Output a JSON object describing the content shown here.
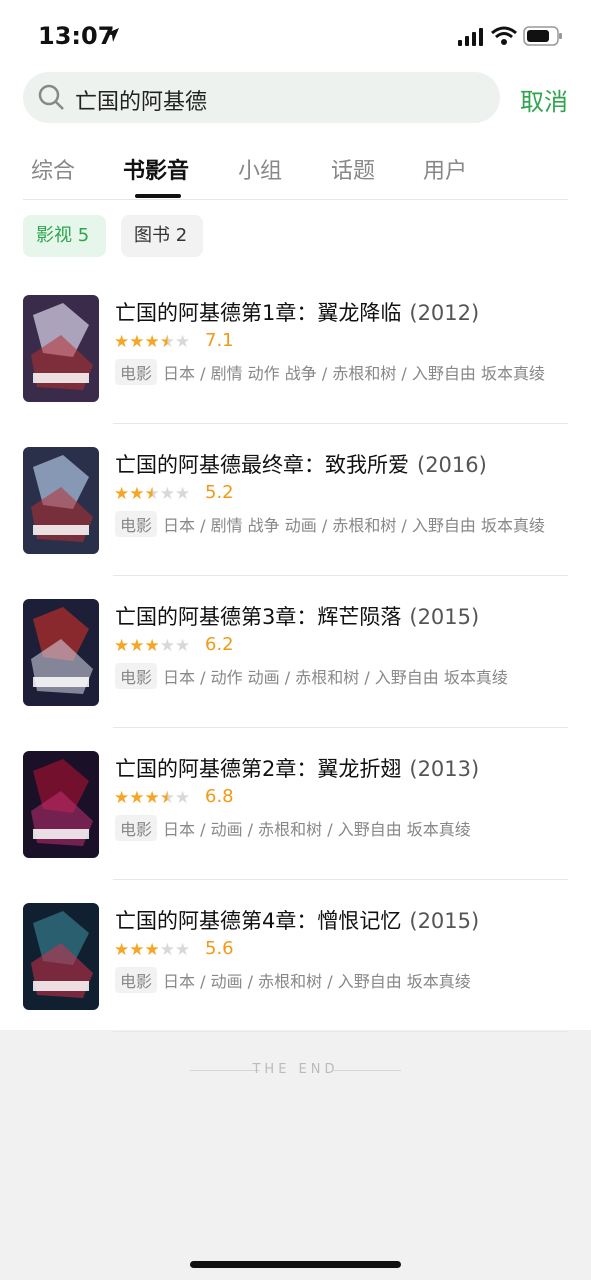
{
  "status": {
    "time": "13:07"
  },
  "search": {
    "query": "亡国的阿基德",
    "cancel_label": "取消"
  },
  "tabs": [
    "综合",
    "书影音",
    "小组",
    "话题",
    "用户"
  ],
  "chips": {
    "movies": "影视 5",
    "books": "图书 2"
  },
  "items": [
    {
      "title": "亡国的阿基德第1章：翼龙降临",
      "year": "(2012)",
      "score": "7.1",
      "rating": 3.5,
      "category": "电影",
      "meta": "日本 / 剧情 动作 战争 / 赤根和树 / 入野自由 坂本真绫"
    },
    {
      "title": "亡国的阿基德最终章：致我所爱",
      "year": "(2016)",
      "score": "5.2",
      "rating": 2.5,
      "category": "电影",
      "meta": "日本 / 剧情 战争 动画 / 赤根和树 / 入野自由 坂本真绫"
    },
    {
      "title": "亡国的阿基德第3章：辉芒陨落",
      "year": "(2015)",
      "score": "6.2",
      "rating": 3,
      "category": "电影",
      "meta": "日本 / 动作 动画 / 赤根和树 / 入野自由 坂本真绫"
    },
    {
      "title": "亡国的阿基德第2章：翼龙折翅",
      "year": "(2013)",
      "score": "6.8",
      "rating": 3.5,
      "category": "电影",
      "meta": "日本 / 动画 / 赤根和树 / 入野自由 坂本真绫"
    },
    {
      "title": "亡国的阿基德第4章：憎恨记忆",
      "year": "(2015)",
      "score": "5.6",
      "rating": 3,
      "category": "电影",
      "meta": "日本 / 动画 / 赤根和树 / 入野自由 坂本真绫"
    }
  ],
  "footer": {
    "end_text": "THE END"
  },
  "colors": {
    "accent": "#2ea44f",
    "star": "#f5a623",
    "score": "#f09a17"
  }
}
